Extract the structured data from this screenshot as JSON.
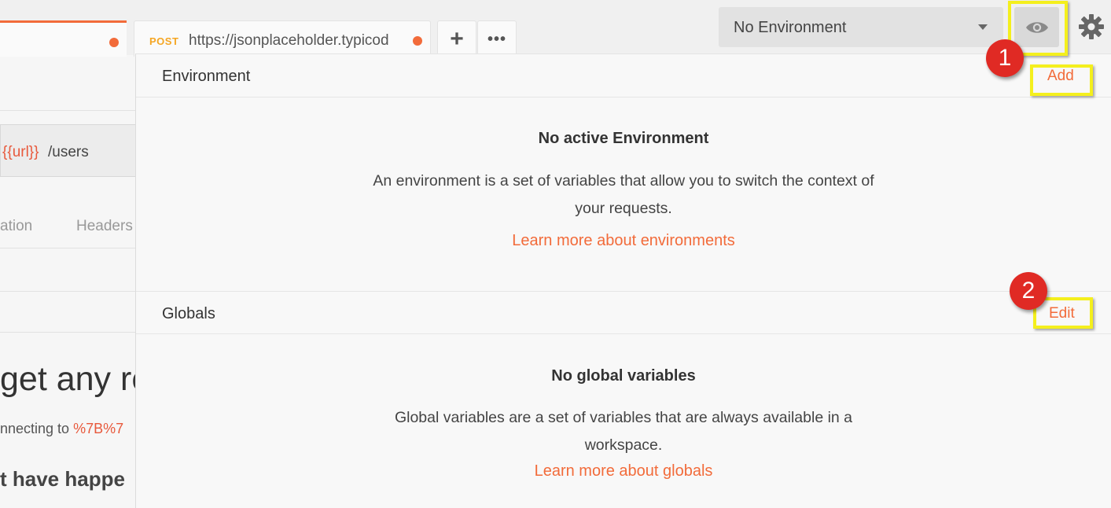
{
  "tabs": {
    "post_method": "POST",
    "post_url": "https://jsonplaceholder.typicod",
    "add_icon": "plus-icon",
    "more_icon": "more-icon"
  },
  "request": {
    "url_var": "{{url}}",
    "url_path": "/users",
    "tabs": [
      "ation",
      "Headers"
    ]
  },
  "response": {
    "title": "get any re",
    "connecting_prefix": "nnecting to ",
    "connecting_url": "%7B%7",
    "happened": "t have happe"
  },
  "environment_bar": {
    "selected": "No Environment",
    "eye_icon": "eye-icon",
    "settings_icon": "gear-icon"
  },
  "popover": {
    "environment": {
      "title": "Environment",
      "action": "Add",
      "empty_title": "No active Environment",
      "empty_desc": "An environment is a set of variables that allow you to switch the context of your requests.",
      "learn_link": "Learn more about environments"
    },
    "globals": {
      "title": "Globals",
      "action": "Edit",
      "empty_title": "No global variables",
      "empty_desc": "Global variables are a set of variables that are always available in a workspace.",
      "learn_link": "Learn more about globals"
    }
  },
  "annotations": {
    "step1": "1",
    "step2": "2",
    "highlight_color": "#f4ef1d",
    "badge_color": "#e02a24"
  }
}
